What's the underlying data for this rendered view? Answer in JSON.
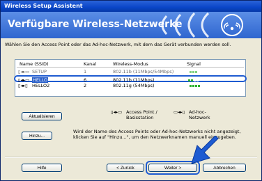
{
  "window": {
    "title": "Wireless Setup Assistent"
  },
  "banner": {
    "title": "Verfügbare Wireless-Netzwerke"
  },
  "instruction": "Wählen Sie den Access Point oder das Ad-hoc-Netzwerk, mit dem das Gerät verbunden werden soll.",
  "list": {
    "headers": {
      "name": "Name (SSID)",
      "channel": "Kanal",
      "mode": "Wireless-Modus",
      "signal": "Signal"
    },
    "rows": [
      {
        "name": "SETUP",
        "channel": "1",
        "mode": "802.11b (11Mbps/54Mbps)",
        "signal_bars": 3
      },
      {
        "name": "HELLO",
        "channel": "6",
        "mode": "802.11b (11Mbps)",
        "signal_bars": 2
      },
      {
        "name": "HELLO2",
        "channel": "2",
        "mode": "802.11g (54Mbps)",
        "signal_bars": 4
      }
    ],
    "selected_index": 1
  },
  "buttons": {
    "refresh": "Aktualisieren",
    "add": "Hinzu...",
    "help": "Hilfe",
    "back": "< Zurück",
    "next": "Weiter >",
    "cancel": "Abbrechen"
  },
  "legend": {
    "ap": "Access Point / Basisstation",
    "adhoc": "Ad-hoc-Netzwerk"
  },
  "note": "Wird der Name des Access Points oder Ad-hoc-Netzwerks nicht angezeigt, klicken Sie auf \"Hinzu...\", um den Netzwerknamen manuell einzugeben.",
  "colors": {
    "accent": "#1e5bd1",
    "signal": "#2fb130",
    "banner": "#2f66cf"
  }
}
